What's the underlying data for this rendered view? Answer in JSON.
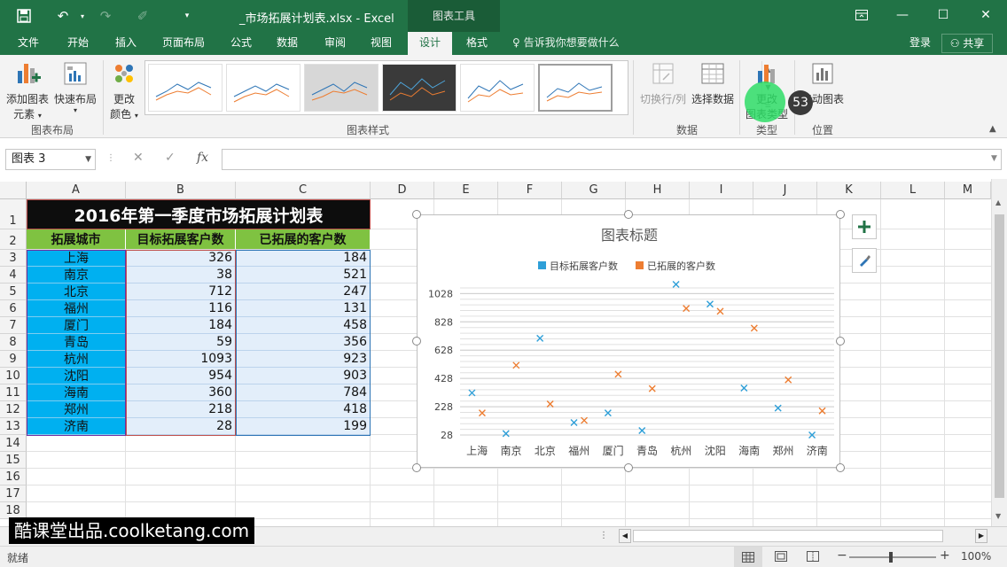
{
  "window": {
    "title": "_市场拓展计划表.xlsx - Excel",
    "tool_tab": "图表工具"
  },
  "tabs": [
    {
      "label": "文件"
    },
    {
      "label": "开始"
    },
    {
      "label": "插入"
    },
    {
      "label": "页面布局"
    },
    {
      "label": "公式"
    },
    {
      "label": "数据"
    },
    {
      "label": "审阅"
    },
    {
      "label": "视图"
    },
    {
      "label": "设计"
    },
    {
      "label": "格式"
    }
  ],
  "tell_me": "告诉我你想要做什么",
  "login": "登录",
  "share": "共享",
  "ribbon": {
    "add_element_line1": "添加图表",
    "add_element_line2": "元素",
    "quick_layout": "快速布局",
    "change_colors_line1": "更改",
    "change_colors_line2": "颜色",
    "group_layout": "图表布局",
    "group_styles": "图表样式",
    "switch_row_col": "切换行/列",
    "select_data": "选择数据",
    "group_data": "数据",
    "change_type_line1": "更改",
    "change_type_line2": "图表类型",
    "group_type": "类型",
    "move_chart": "移动图表",
    "group_location": "位置",
    "badge": "53"
  },
  "formula_bar": {
    "name_box": "图表 3",
    "fx": "fx",
    "cancel": "✕",
    "confirm": "✓"
  },
  "columns": [
    "A",
    "B",
    "C",
    "D",
    "E",
    "F",
    "G",
    "H",
    "I",
    "J",
    "K",
    "L",
    "M"
  ],
  "rows": [
    "1",
    "2",
    "3",
    "4",
    "5",
    "6",
    "7",
    "8",
    "9",
    "10",
    "11",
    "12",
    "13",
    "14",
    "15",
    "16",
    "17",
    "18"
  ],
  "sheet": {
    "title": "2016年第一季度市场拓展计划表",
    "headers": [
      "拓展城市",
      "目标拓展客户数",
      "已拓展的客户数"
    ],
    "data": [
      [
        "上海",
        "326",
        "184"
      ],
      [
        "南京",
        "38",
        "521"
      ],
      [
        "北京",
        "712",
        "247"
      ],
      [
        "福州",
        "116",
        "131"
      ],
      [
        "厦门",
        "184",
        "458"
      ],
      [
        "青岛",
        "59",
        "356"
      ],
      [
        "杭州",
        "1093",
        "923"
      ],
      [
        "沈阳",
        "954",
        "903"
      ],
      [
        "海南",
        "360",
        "784"
      ],
      [
        "郑州",
        "218",
        "418"
      ],
      [
        "济南",
        "28",
        "199"
      ]
    ]
  },
  "chart_data": {
    "type": "scatter",
    "title": "图表标题",
    "categories": [
      "上海",
      "南京",
      "北京",
      "福州",
      "厦门",
      "青岛",
      "杭州",
      "沈阳",
      "海南",
      "郑州",
      "济南"
    ],
    "series": [
      {
        "name": "目标拓展客户数",
        "values": [
          326,
          38,
          712,
          116,
          184,
          59,
          1093,
          954,
          360,
          218,
          28
        ],
        "color": "#2e9fd8"
      },
      {
        "name": "已拓展的客户数",
        "values": [
          184,
          521,
          247,
          131,
          458,
          356,
          923,
          903,
          784,
          418,
          199
        ],
        "color": "#ed7d31"
      }
    ],
    "yticks": [
      28,
      228,
      428,
      628,
      828,
      1028
    ],
    "ylim": [
      28,
      1068
    ],
    "grid": true,
    "legend": "top",
    "marker": "x"
  },
  "status": {
    "ready": "就绪",
    "zoom": "100%"
  },
  "watermark": "酷课堂出品.coolketang.com",
  "colors": {
    "excel_green": "#217346",
    "title_fill": "#0d0d0d",
    "header_fill": "#7fc241",
    "city_fill": "#00b0f0",
    "value_fill": "#e3eefa"
  }
}
